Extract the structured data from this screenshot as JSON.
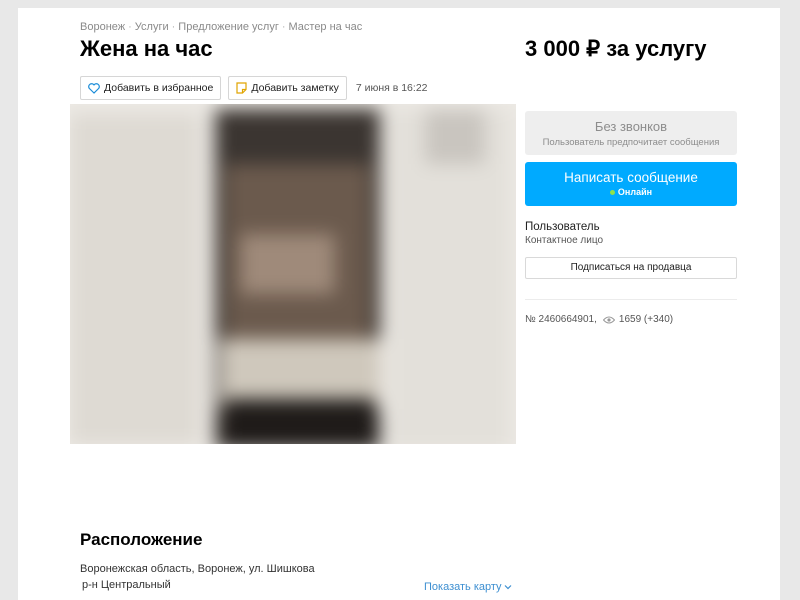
{
  "breadcrumbs": [
    "Воронеж",
    "Услуги",
    "Предложение услуг",
    "Мастер на час"
  ],
  "title": "Жена на час",
  "price": "3 000 ₽ за услугу",
  "actions": {
    "favorite_label": "Добавить в избранное",
    "note_label": "Добавить заметку",
    "date": "7 июня в 16:22"
  },
  "contact": {
    "no_calls_title": "Без звонков",
    "no_calls_subtitle": "Пользователь предпочитает сообщения",
    "message_button": "Написать сообщение",
    "online_status": "Онлайн"
  },
  "seller": {
    "name": "Пользователь",
    "role": "Контактное лицо",
    "subscribe_label": "Подписаться на продавца"
  },
  "listing_meta": {
    "number": "№ 2460664901,",
    "views": "1659 (+340)"
  },
  "location": {
    "title": "Расположение",
    "address": "Воронежская область, Воронеж, ул. Шишкова",
    "district": "р-н Центральный",
    "show_map_label": "Показать карту"
  },
  "colors": {
    "accent": "#00aaff",
    "link": "#3d8fd1",
    "online": "#8fe24a"
  }
}
